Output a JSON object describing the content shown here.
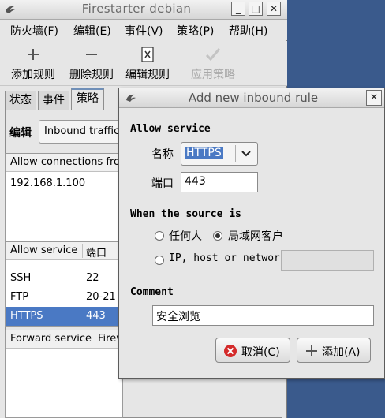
{
  "main_window": {
    "title": "Firestarter debian",
    "controls": {
      "minimize": "_",
      "maximize": "□",
      "close": "✕"
    },
    "menu": [
      "防火墙(F)",
      "编辑(E)",
      "事件(V)",
      "策略(P)",
      "帮助(H)"
    ],
    "toolbar": {
      "add": "添加规则",
      "remove": "删除规则",
      "edit": "编辑规则",
      "apply": "应用策略"
    },
    "tabs": [
      "状态",
      "事件",
      "策略"
    ],
    "policy": {
      "edit_label": "编辑",
      "combo_value": "Inbound traffic policy",
      "connections_header": "Allow connections from host",
      "connections": [
        "192.168.1.100"
      ],
      "services_headers": [
        "Allow service",
        "端口"
      ],
      "services": [
        {
          "name": "SSH",
          "port": "22"
        },
        {
          "name": "FTP",
          "port": "20-21"
        },
        {
          "name": "HTTPS",
          "port": "443"
        }
      ],
      "forward_headers": [
        "Forward service",
        "Firewall port"
      ]
    }
  },
  "dialog": {
    "title": "Add new inbound rule",
    "close": "✕",
    "allow_service": "Allow service",
    "name_label": "名称",
    "name_value": "HTTPS",
    "port_label": "端口",
    "port_value": "443",
    "source_heading": "When the source is",
    "opt_anyone": "任何人",
    "opt_lan": "局域网客户",
    "opt_ip": "IP, host or network",
    "comment_heading": "Comment",
    "comment_value": "安全浏览",
    "cancel": "取消(C)",
    "add": "添加(A)"
  }
}
